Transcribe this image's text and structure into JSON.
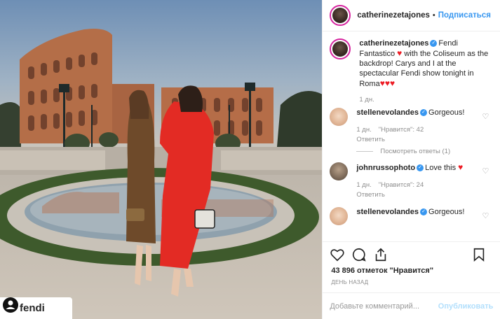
{
  "photo": {
    "tag_label": "fendi",
    "tag_icon": "user-silhouette-icon"
  },
  "header": {
    "username": "catherinezetajones",
    "separator": "•",
    "follow_label": "Подписаться"
  },
  "caption": {
    "username": "catherinezetajones",
    "text_1": "Fendi Fantastico",
    "text_2": "with the Coliseum as the backdrop! Carys and I at the spectacular Fendi show tonight in Roma",
    "time": "1 дн."
  },
  "comments": [
    {
      "username": "stellenevolandes",
      "text": "Gorgeous!",
      "time": "1 дн.",
      "likes": "\"Нравится\": 42",
      "reply": "Ответить",
      "view_replies": "Посмотреть ответы (1)"
    },
    {
      "username": "johnrussophoto",
      "text": "Love this",
      "time": "1 дн.",
      "likes": "\"Нравится\": 24",
      "reply": "Ответить"
    },
    {
      "username": "stellenevolandes",
      "text": "Gorgeous!"
    }
  ],
  "actions": {
    "like_icon": "heart-outline-icon",
    "comment_icon": "comment-bubble-icon",
    "share_icon": "share-icon",
    "save_icon": "bookmark-icon"
  },
  "likes_text": "43 896 отметок \"Нравится\"",
  "date_text": "ДЕНЬ НАЗАД",
  "comment_box": {
    "placeholder": "Добавьте комментарий...",
    "post_label": "Опубликовать"
  },
  "colors": {
    "accent": "#3897f0",
    "heart": "#ed1c24",
    "muted": "#8e8e8e"
  }
}
